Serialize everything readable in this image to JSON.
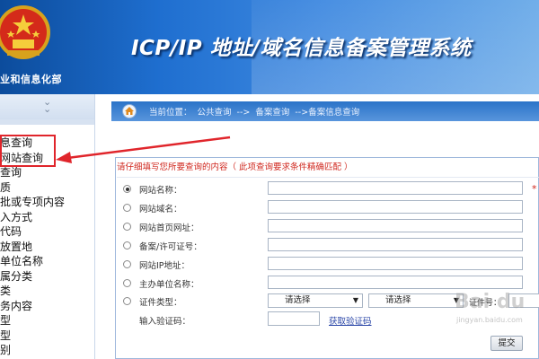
{
  "header": {
    "title": "ICP/IP 地址/域名信息备案管理系统",
    "ministry": "业和信息化部"
  },
  "sidebar": {
    "items": [
      {
        "label": "息查询"
      },
      {
        "label": "网站查询"
      },
      {
        "label": "查询"
      },
      {
        "label": "质"
      },
      {
        "label": "批或专项内容"
      },
      {
        "label": "入方式"
      },
      {
        "label": "代码"
      },
      {
        "label": "放置地"
      },
      {
        "label": "单位名称"
      },
      {
        "label": "属分类"
      },
      {
        "label": "类"
      },
      {
        "label": "务内容"
      },
      {
        "label": "型"
      },
      {
        "label": "型"
      },
      {
        "label": "别"
      }
    ]
  },
  "breadcrumb": {
    "prefix": "当前位置：",
    "items": [
      "公共查询",
      "-->",
      "备案查询",
      "-->备案信息查询"
    ]
  },
  "form": {
    "hint": "请仔细填写您所要查询的内容（ 此项查询要求条件精确匹配 ）",
    "fields": [
      {
        "label": "网站名称："
      },
      {
        "label": "网站域名："
      },
      {
        "label": "网站首页网址："
      },
      {
        "label": "备案/许可证号："
      },
      {
        "label": "网站IP地址："
      },
      {
        "label": "主办单位名称："
      },
      {
        "label": "证件类型："
      }
    ],
    "required_mark": "*",
    "select1": "请选择",
    "select2": "请选择",
    "cert_no_label": "证件号：",
    "captcha_label": "输入验证码：",
    "captcha_link": "获取验证码",
    "submit": "提交"
  },
  "watermark": {
    "text": "Bai du",
    "sub": "jingyan.baidu.com"
  },
  "colors": {
    "header_dark": "#0c4c9c",
    "header_light": "#6aaae8",
    "annotation_red": "#e0252b",
    "hint_red": "#d0281f"
  }
}
